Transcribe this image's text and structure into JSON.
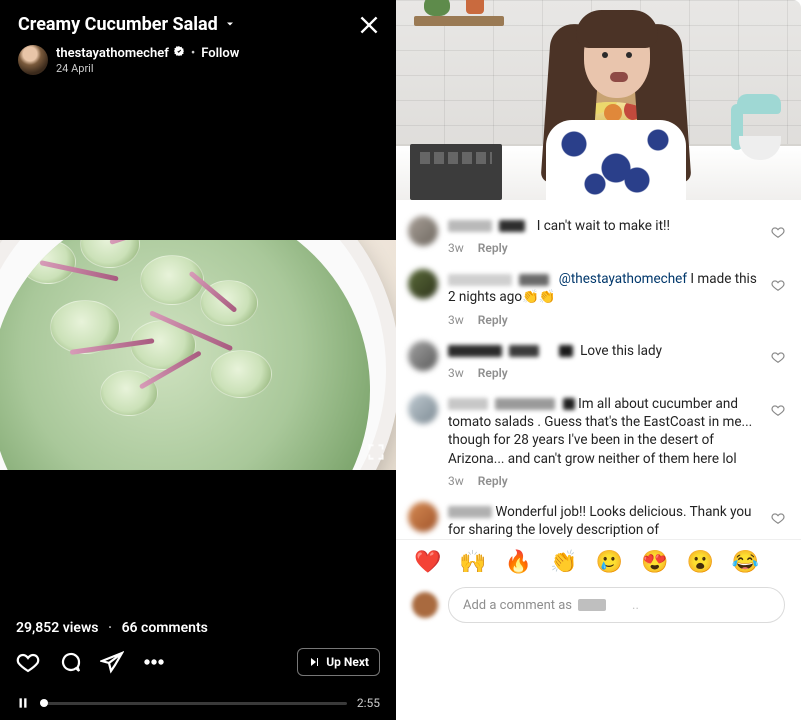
{
  "video": {
    "title": "Creamy Cucumber Salad",
    "close_label": "Close",
    "account": {
      "username": "thestayathomechef",
      "verified": true,
      "follow_label": "Follow",
      "date": "24 April"
    },
    "stats": {
      "views_text": "29,852 views",
      "dot": "·",
      "comments_text": "66 comments"
    },
    "actions": {
      "like_label": "Like",
      "comment_label": "Comment",
      "share_label": "Share",
      "more_label": "More",
      "upnext_label": "Up Next"
    },
    "player": {
      "state": "playing",
      "time_label": "2:55"
    }
  },
  "comments": {
    "items": [
      {
        "text": "I can't wait to make it!!",
        "age": "3w",
        "reply_label": "Reply"
      },
      {
        "mention": "@thestayathomechef",
        "text_after": " I made this 2 nights ago👏👏",
        "age": "3w",
        "reply_label": "Reply"
      },
      {
        "leading_redactions": 2,
        "text": "Love this lady",
        "age": "3w",
        "reply_label": "Reply"
      },
      {
        "text": "Im all about cucumber and tomato salads . Guess that's the EastCoast in me... though for 28 years I've been in the desert of Arizona... and can't grow neither of them here lol",
        "age": "3w",
        "reply_label": "Reply"
      },
      {
        "text": "Wonderful job!! Looks delicious. Thank you for sharing the lovely description of",
        "age": "",
        "reply_label": ""
      }
    ],
    "reactions": [
      "❤️",
      "🙌",
      "🔥",
      "👏",
      "🥲",
      "😍",
      "😮",
      "😂"
    ],
    "input_placeholder": "Add a comment as"
  }
}
